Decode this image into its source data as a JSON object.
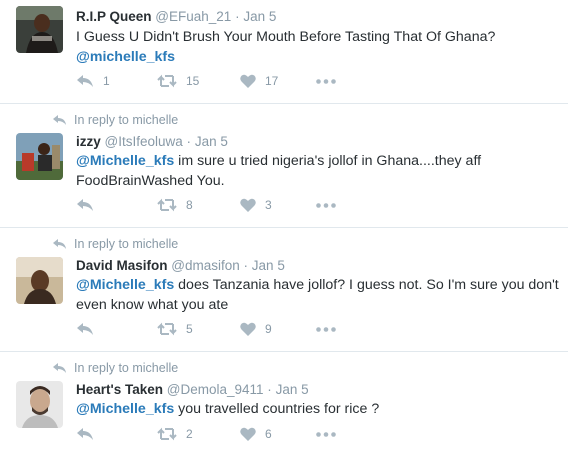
{
  "tweets": [
    {
      "name": "R.I.P Queen",
      "handle": "@EFuah_21",
      "dot": "·",
      "time": "Jan 5",
      "text_line1": "I Guess U Didn't Brush Your Mouth Before Tasting That Of Ghana?",
      "mention": "@michelle_kfs",
      "text": "",
      "retweets": "1",
      "likes": "15",
      "views": "17"
    },
    {
      "reply_context": "In reply to michelle",
      "name": "izzy",
      "handle": "@ItsIfeoluwa",
      "dot": "·",
      "time": "Jan 5",
      "mention": "@Michelle_kfs",
      "text": " im sure u tried nigeria's jollof in Ghana....they aff FoodBrainWashed You.",
      "retweets": "8",
      "likes": "3"
    },
    {
      "reply_context": "In reply to michelle",
      "name": "David Masifon",
      "handle": "@dmasifon",
      "dot": "·",
      "time": "Jan 5",
      "mention": "@Michelle_kfs",
      "text": " does Tanzania have jollof? I guess not. So I'm sure you don't even know what you ate",
      "retweets": "5",
      "likes": "9"
    },
    {
      "reply_context": "In reply to michelle",
      "name": "Heart's Taken",
      "handle": "@Demola_9411",
      "dot": "·",
      "time": "Jan 5",
      "mention": "@Michelle_kfs",
      "text": " you travelled countries for rice ?",
      "retweets": "2",
      "likes": "6"
    }
  ],
  "colors": {
    "mention": "#2b7bb9",
    "icon": "#aab8c2",
    "meta": "#8899a6",
    "divider": "#e1e8ed"
  },
  "icons": [
    "reply-icon",
    "retweet-icon",
    "heart-icon",
    "more-icon",
    "reply-context-icon"
  ]
}
